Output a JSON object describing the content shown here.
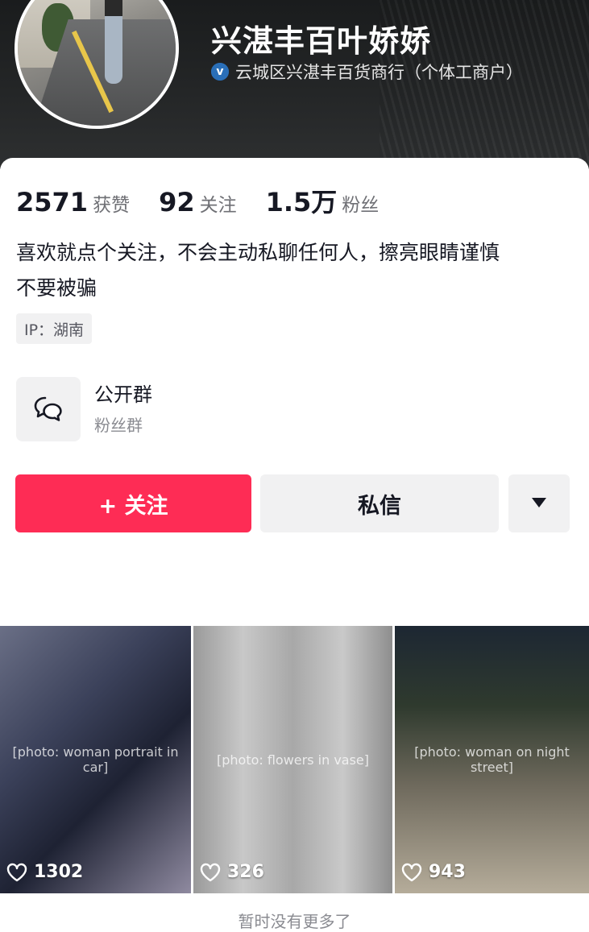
{
  "profile": {
    "name": "兴湛丰百叶娇娇",
    "verified_text": "云城区兴湛丰百货商行（个体工商户）",
    "verified_icon": "verified-badge-icon",
    "avatar_description": "avatar-photo"
  },
  "stats": [
    {
      "value": "2571",
      "label": "获赞"
    },
    {
      "value": "92",
      "label": "关注"
    },
    {
      "value": "1.5万",
      "label": "粉丝"
    }
  ],
  "bio": {
    "line1": "喜欢就点个关注，不会主动私聊任何人，擦亮眼睛谨慎",
    "line2": "不要被骗"
  },
  "ip_tag": "IP：湖南",
  "group": {
    "title": "公开群",
    "subtitle": "粉丝群",
    "icon": "chat-bubbles-icon"
  },
  "actions": {
    "follow_label": "+ 关注",
    "message_label": "私信",
    "more_icon": "triangle-down-icon"
  },
  "videos": [
    {
      "likes": "1302",
      "photo_label": "[photo: woman portrait in car]"
    },
    {
      "likes": "326",
      "photo_label": "[photo: flowers in vase]"
    },
    {
      "likes": "943",
      "photo_label": "[photo: woman on night street]"
    }
  ],
  "footer": "暂时没有更多了",
  "colors": {
    "accent": "#fe2c55",
    "button_gray": "#f1f1f2",
    "text_primary": "#161823",
    "text_secondary": "#6f7075",
    "header_bg": "#242627"
  }
}
